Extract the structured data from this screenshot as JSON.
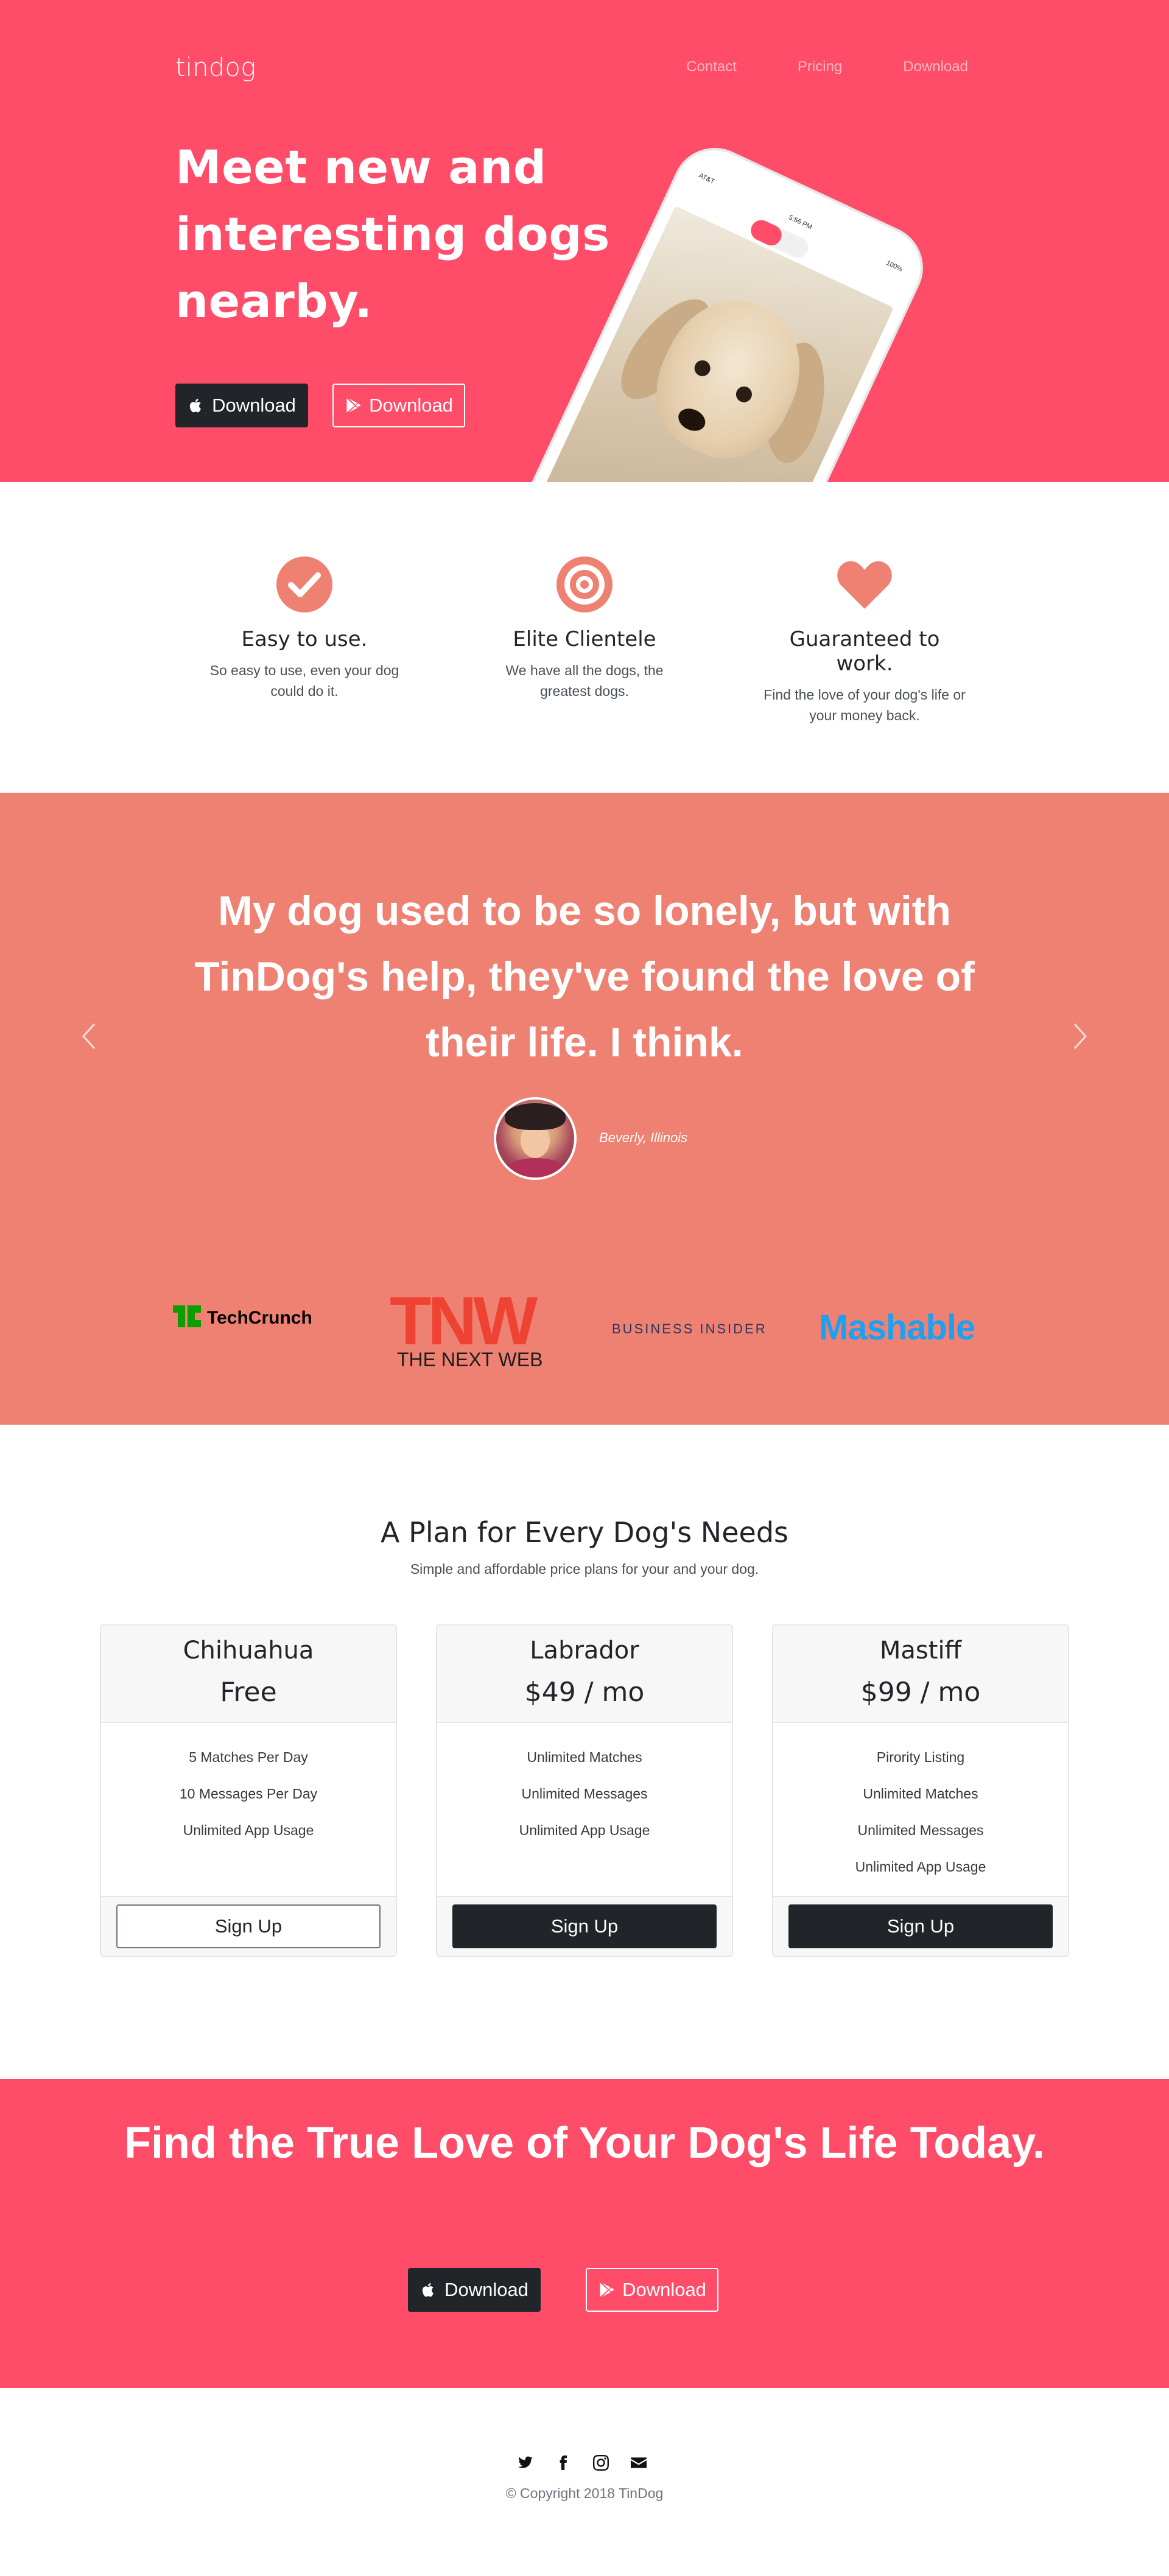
{
  "nav": {
    "brand": "tindog",
    "links": [
      "Contact",
      "Pricing",
      "Download"
    ]
  },
  "hero": {
    "title": "Meet new and interesting dogs nearby.",
    "apple_button": "Download",
    "google_button": "Download",
    "phone_status": {
      "carrier": "AT&T",
      "time": "5:56 PM",
      "battery": "100%"
    }
  },
  "features": [
    {
      "icon": "check-circle-icon",
      "title": "Easy to use.",
      "text": "So easy to use, even your dog could do it."
    },
    {
      "icon": "bullseye-icon",
      "title": "Elite Clientele",
      "text": "We have all the dogs, the greatest dogs."
    },
    {
      "icon": "heart-icon",
      "title": "Guaranteed to work.",
      "text": "Find the love of your dog's life or your money back."
    }
  ],
  "testimonial": {
    "quote": "My dog used to be so lonely, but with TinDog's help, they've found the love of their life. I think.",
    "location": "Beverly, Illinois"
  },
  "press": [
    "TechCrunch",
    "THE NEXT WEB",
    "BUSINESS INSIDER",
    "Mashable"
  ],
  "pricing": {
    "title": "A Plan for Every Dog's Needs",
    "subtitle": "Simple and affordable price plans for your and your dog.",
    "plans": [
      {
        "name": "Chihuahua",
        "price": "Free",
        "features": [
          "5 Matches Per Day",
          "10 Messages Per Day",
          "Unlimited App Usage"
        ],
        "button": "Sign Up"
      },
      {
        "name": "Labrador",
        "price": "$49 / mo",
        "features": [
          "Unlimited Matches",
          "Unlimited Messages",
          "Unlimited App Usage"
        ],
        "button": "Sign Up"
      },
      {
        "name": "Mastiff",
        "price": "$99 / mo",
        "features": [
          "Pirority Listing",
          "Unlimited Matches",
          "Unlimited Messages",
          "Unlimited App Usage"
        ],
        "button": "Sign Up"
      }
    ]
  },
  "cta": {
    "title": "Find the True Love of Your Dog's Life Today.",
    "apple_button": "Download",
    "google_button": "Download"
  },
  "footer": {
    "socials": [
      "twitter-icon",
      "facebook-icon",
      "instagram-icon",
      "envelope-icon"
    ],
    "copyright": "© Copyright 2018 TinDog"
  },
  "colors": {
    "primary": "#ff4c68",
    "secondary": "#ef8172",
    "dark": "#212529"
  }
}
